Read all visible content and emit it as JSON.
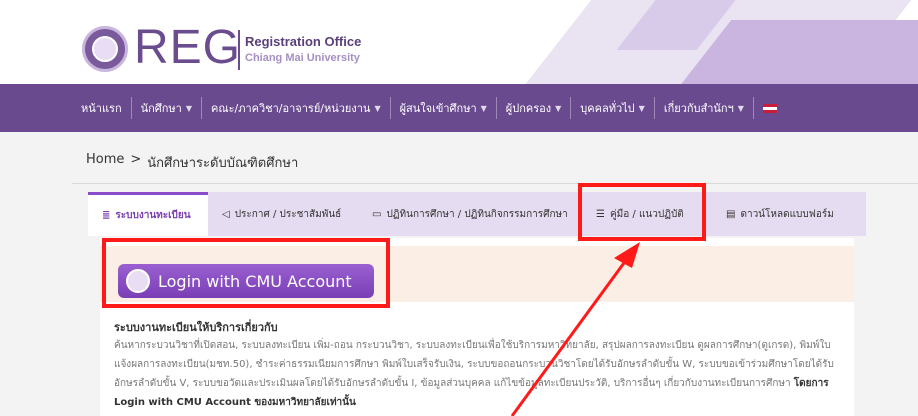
{
  "header": {
    "logo_text": "REG",
    "org_line1": "Registration Office",
    "org_line2": "Chiang Mai University"
  },
  "nav": {
    "items": [
      {
        "label": "หน้าแรก",
        "caret": false
      },
      {
        "label": "นักศึกษา",
        "caret": true
      },
      {
        "label": "คณะ/ภาควิชา/อาจารย์/หน่วยงาน",
        "caret": true
      },
      {
        "label": "ผู้สนใจเข้าศึกษา",
        "caret": true
      },
      {
        "label": "ผู้ปกครอง",
        "caret": true
      },
      {
        "label": "บุคคลทั่วไป",
        "caret": true
      },
      {
        "label": "เกี่ยวกับสำนักฯ",
        "caret": true
      }
    ],
    "caret_glyph": "▼"
  },
  "breadcrumb": {
    "home": "Home",
    "separator": ">",
    "current": "นักศึกษาระดับบัณฑิตศึกษา"
  },
  "tabs": [
    {
      "label": "ระบบงานทะเบียน",
      "icon": "database-icon",
      "glyph": "≣",
      "active": true
    },
    {
      "label": "ประกาศ / ประชาสัมพันธ์",
      "icon": "megaphone-icon",
      "glyph": "◁",
      "active": false
    },
    {
      "label": "ปฏิทินการศึกษา / ปฏิทินกิจกรรมการศึกษา",
      "icon": "calendar-icon",
      "glyph": "▭",
      "active": false
    },
    {
      "label": "คู่มือ / แนวปฏิบัติ",
      "icon": "list-icon",
      "glyph": "☰",
      "active": false
    },
    {
      "label": "ดาวน์โหลดแบบฟอร์ม",
      "icon": "file-icon",
      "glyph": "▤",
      "active": false
    }
  ],
  "login": {
    "button_label": "Login with CMU Account"
  },
  "content": {
    "title": "ระบบงานทะเบียนให้บริการเกี่ยวกับ",
    "body": "ค้นหากระบวนวิชาที่เปิดสอน, ระบบลงทะเบียน เพิ่ม-ถอน กระบวนวิชา, ระบบลงทะเบียนเพื่อใช้บริการมหาวิทยาลัย, สรุปผลการลงทะเบียน ดูผลการศึกษา(ดูเกรด), พิมพ์ใบแจ้งผลการลงทะเบียน(มชท.50), ชำระค่าธรรมเนียมการศึกษา พิมพ์ใบเสร็จรับเงิน, ระบบขอถอนกระบวนวิชาโดยได้รับอักษรลำดับขั้น W, ระบบขอเข้าร่วมศึกษาโดยได้รับอักษรลำดับขั้น V, ระบบขอวัดและประเมินผลโดยได้รับอักษรลำดับขั้น I, ข้อมูลส่วนบุคคล แก้ไขข้อมูลทะเบียนประวัติ, บริการอื่นๆ เกี่ยวกับงานทะเบียนการศึกษา ",
    "body_bold": "โดยการ Login with CMU Account ของมหาวิทยาลัยเท่านั้น"
  },
  "colors": {
    "brand_purple": "#6a4a8f",
    "tab_bar": "#e6dcf1",
    "active_tab_text": "#7a3fb0",
    "login_bar": "#fbeee4",
    "annotation_red": "#ff1a1a"
  }
}
